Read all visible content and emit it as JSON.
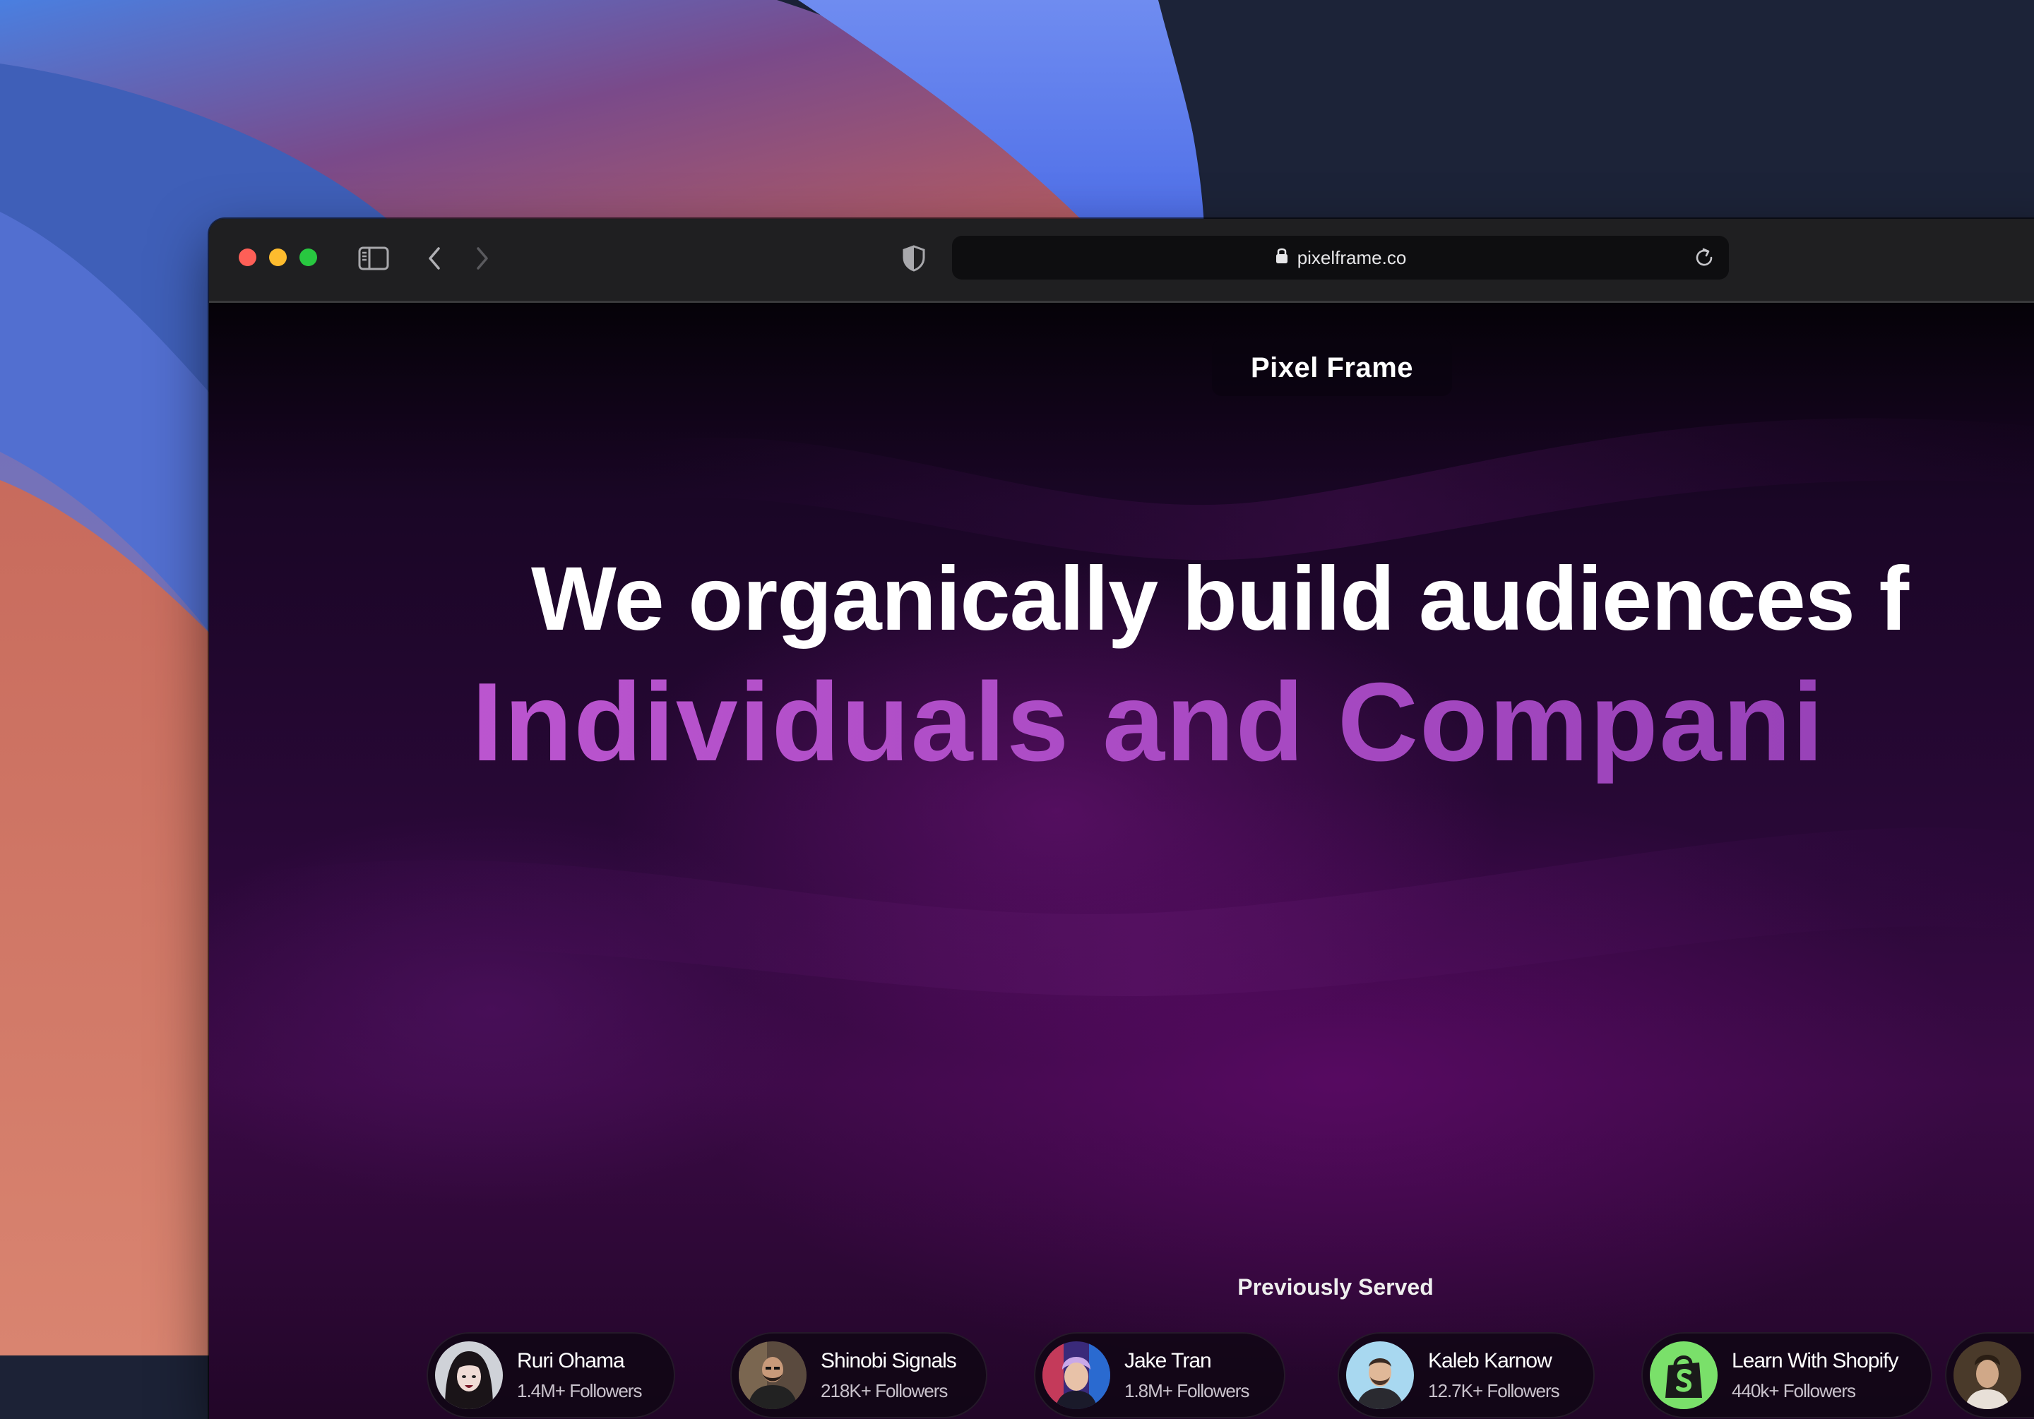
{
  "browser": {
    "url": "pixelframe.co",
    "icons": {
      "sidebar": "sidebar-icon",
      "back": "chevron-left-icon",
      "forward": "chevron-right-icon",
      "privacy": "shield-icon",
      "lock": "lock-icon",
      "reload": "reload-icon"
    }
  },
  "page": {
    "brand": "Pixel Frame",
    "headline_line1": "We organically build audiences f",
    "headline_line2": "Individuals and Compani",
    "served_title": "Previously Served",
    "clients": [
      {
        "name": "Ruri Ohama",
        "followers": "1.4M+ Followers"
      },
      {
        "name": "Shinobi Signals",
        "followers": "218K+ Followers"
      },
      {
        "name": "Jake Tran",
        "followers": "1.8M+ Followers"
      },
      {
        "name": "Kaleb Karnow",
        "followers": "12.7K+ Followers"
      },
      {
        "name": "Learn With Shopify",
        "followers": "440k+ Followers"
      }
    ]
  },
  "colors": {
    "accent_purple": "#b34fc8",
    "traffic_red": "#fe5f57",
    "traffic_yellow": "#febc2e",
    "traffic_green": "#28c840"
  }
}
